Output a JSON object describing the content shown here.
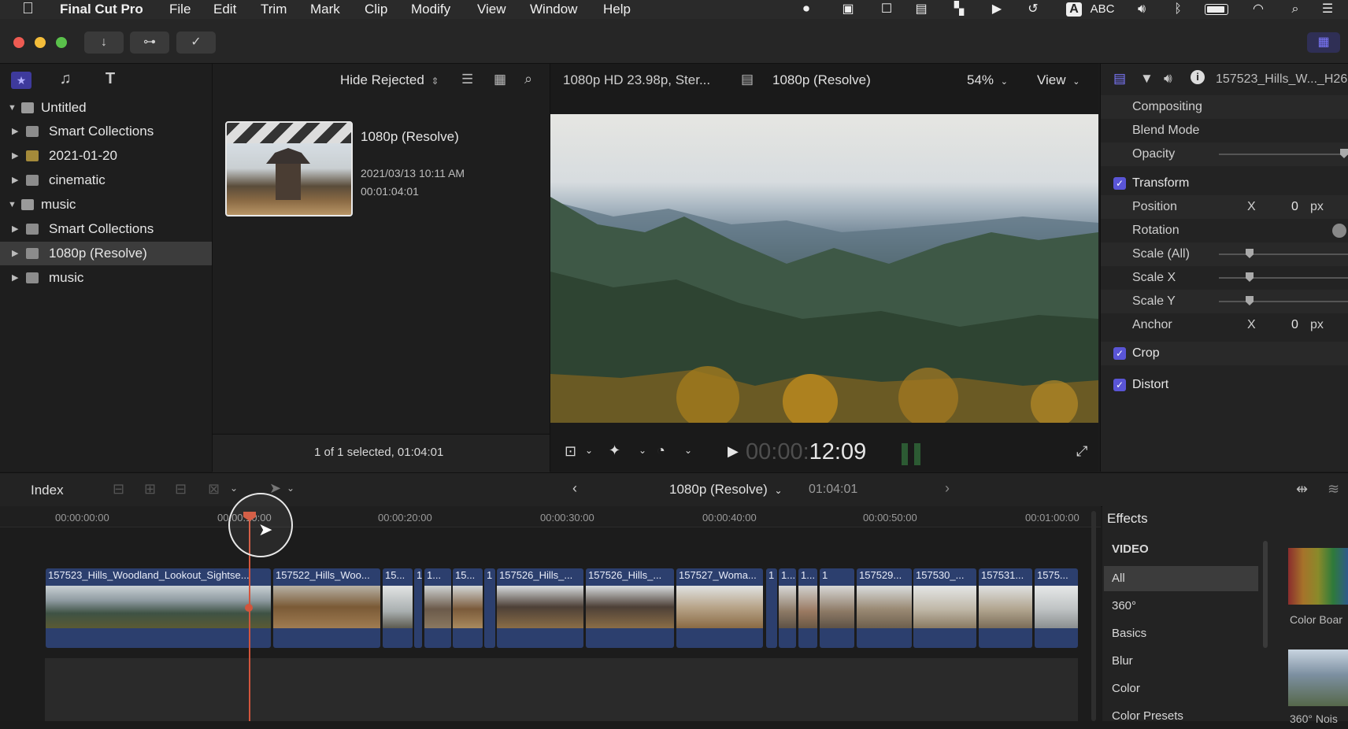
{
  "menubar": {
    "app_name": "Final Cut Pro",
    "items": [
      "File",
      "Edit",
      "Trim",
      "Mark",
      "Clip",
      "Modify",
      "View",
      "Window",
      "Help"
    ],
    "input_source": "ABC"
  },
  "toolbar": {
    "import_icon": "↓",
    "keywords_icon": "⊶",
    "check_icon": "✓"
  },
  "libraries": {
    "rows": [
      {
        "label": "Untitled",
        "type": "library"
      },
      {
        "label": "Smart Collections",
        "type": "folder"
      },
      {
        "label": "2021-01-20",
        "type": "event"
      },
      {
        "label": "cinematic",
        "type": "event"
      },
      {
        "label": "music",
        "type": "library"
      },
      {
        "label": "Smart Collections",
        "type": "folder"
      },
      {
        "label": "1080p (Resolve)",
        "type": "event"
      },
      {
        "label": "music",
        "type": "event"
      }
    ]
  },
  "browser": {
    "filter": "Hide Rejected",
    "clip_name": "1080p (Resolve)",
    "clip_date": "2021/03/13 10:11 AM",
    "clip_duration": "00:01:04:01",
    "status": "1 of 1 selected, 01:04:01"
  },
  "viewer": {
    "format": "1080p HD 23.98p, Ster...",
    "project": "1080p (Resolve)",
    "zoom": "54%",
    "view_label": "View",
    "timecode_dim": "00:00:",
    "timecode_bright": "12:09"
  },
  "inspector": {
    "title": "157523_Hills_W..._H26",
    "rows": {
      "compositing": "Compositing",
      "blend_mode": "Blend Mode",
      "opacity": "Opacity",
      "transform": "Transform",
      "position": "Position",
      "position_axis": "X",
      "position_value": "0",
      "position_unit": "px",
      "rotation": "Rotation",
      "scale_all": "Scale (All)",
      "scale_x": "Scale X",
      "scale_y": "Scale Y",
      "anchor": "Anchor",
      "anchor_axis": "X",
      "anchor_value": "0",
      "anchor_unit": "px",
      "crop": "Crop",
      "distort": "Distort"
    }
  },
  "timeline": {
    "index_label": "Index",
    "project": "1080p (Resolve)",
    "duration": "01:04:01",
    "ruler": [
      "00:00:00:00",
      "00:00:10:00",
      "00:00:20:00",
      "00:00:30:00",
      "00:00:40:00",
      "00:00:50:00",
      "00:01:00:00"
    ],
    "clips": [
      "157523_Hills_Woodland_Lookout_Sightse...",
      "157522_Hills_Woo...",
      "15...",
      "1",
      "1...",
      "15...",
      "1",
      "157526_Hills_...",
      "157526_Hills_...",
      "157527_Woma...",
      "1",
      "1...",
      "1...",
      "1",
      "157529...",
      "157530_...",
      "157531...",
      "1575..."
    ]
  },
  "effects": {
    "title": "Effects",
    "section": "VIDEO",
    "items": [
      "All",
      "360°",
      "Basics",
      "Blur",
      "Color",
      "Color Presets"
    ],
    "thumbs": [
      "Color Boar",
      "360° Nois"
    ]
  },
  "colors": {
    "accent": "#5a55d6",
    "playhead": "#d2553c",
    "clip": "#2c3f6e"
  }
}
